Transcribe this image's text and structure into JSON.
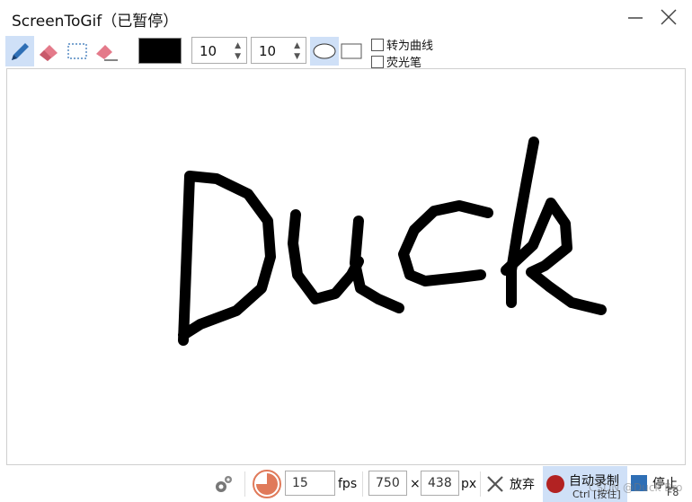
{
  "window": {
    "title": "ScreenToGif（已暂停）",
    "minimize_icon": "minimize-icon",
    "close_icon": "close-icon"
  },
  "toolbar": {
    "tools": [
      {
        "name": "pen-icon",
        "active": true
      },
      {
        "name": "eraser-icon",
        "active": false
      },
      {
        "name": "rectangle-select-icon",
        "active": false
      },
      {
        "name": "clear-eraser-icon",
        "active": false
      }
    ],
    "color": "#000000",
    "width_value": "10",
    "height_value": "10",
    "shapes": [
      {
        "name": "ellipse-shape-icon",
        "active": true
      },
      {
        "name": "rectangle-shape-icon",
        "active": false
      }
    ],
    "fit_to_curve_label": "转为曲线",
    "highlighter_label": "荧光笔"
  },
  "canvas": {
    "drawing_text": "Duck",
    "stroke_color": "#000000"
  },
  "bottom": {
    "settings_icon": "gear-icon",
    "snapshot_icon": "snapshot-icon",
    "fps_value": "15",
    "fps_label": "fps",
    "width_value": "750",
    "times_label": "×",
    "height_value": "438",
    "px_label": "px",
    "discard_label": "放弃",
    "record_label": "自动录制",
    "record_shortcut": "Ctrl [按住]",
    "stop_label": "停止",
    "stop_shortcut": "F8",
    "watermark": "CSDN @Duck Bro"
  }
}
